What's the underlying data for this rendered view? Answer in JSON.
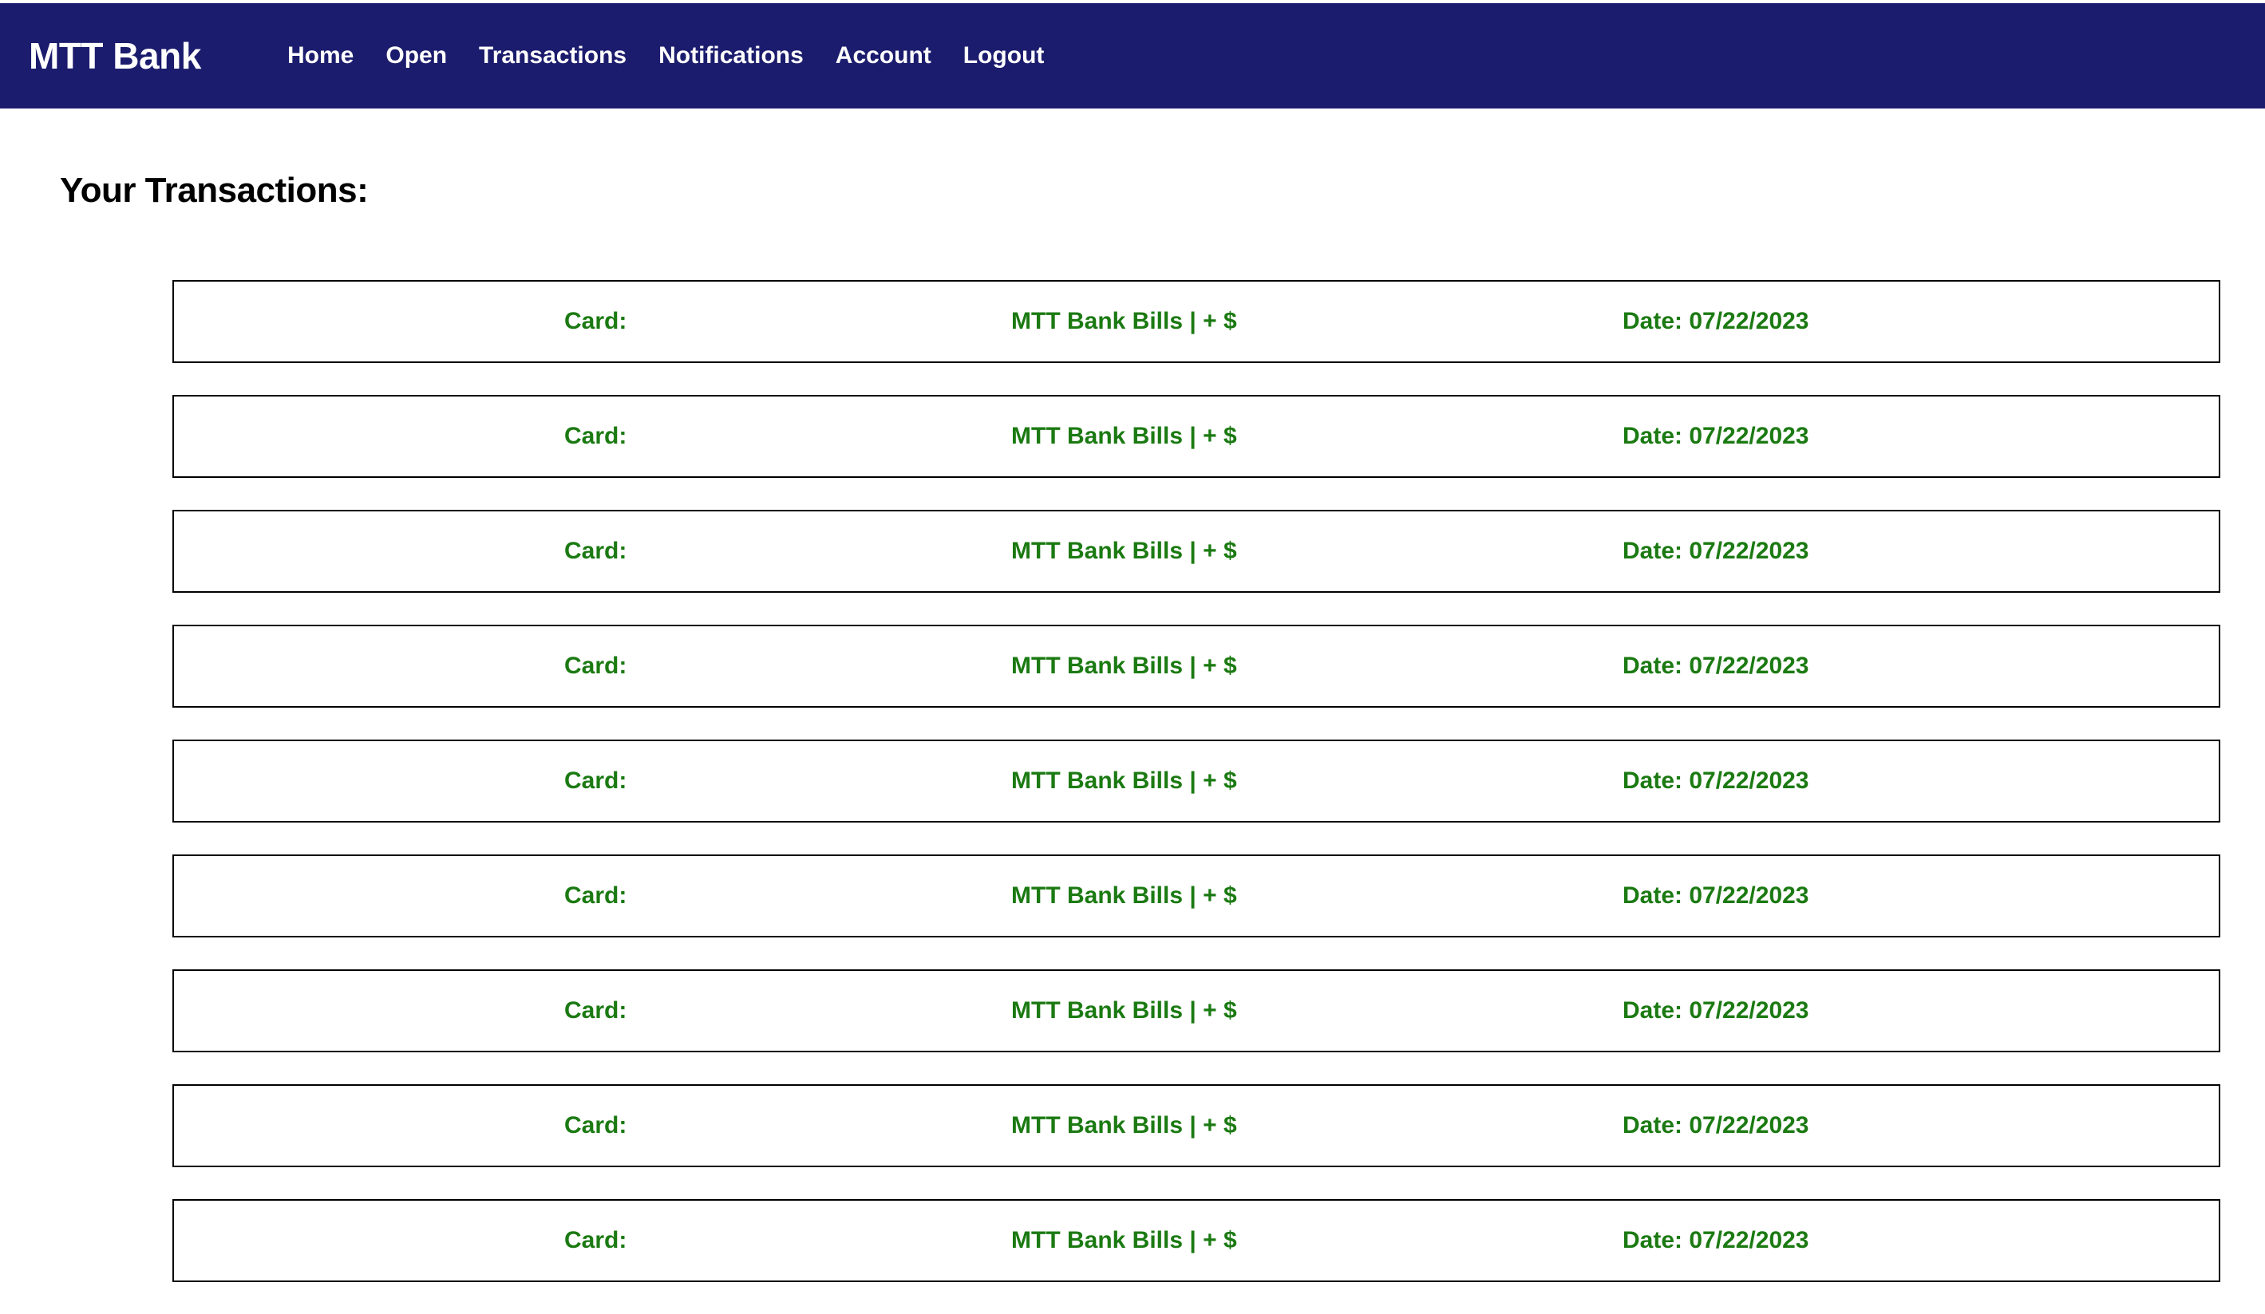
{
  "navbar": {
    "brand": "MTT Bank",
    "links": [
      "Home",
      "Open",
      "Transactions",
      "Notifications",
      "Account",
      "Logout"
    ],
    "background_color": "#1c1c6e"
  },
  "main": {
    "title": "Your Transactions:",
    "text_color": "#1b7a12",
    "transactions": [
      {
        "card": "Card:",
        "description": "MTT Bank Bills | + $",
        "date": "Date: 07/22/2023"
      },
      {
        "card": "Card:",
        "description": "MTT Bank Bills | + $",
        "date": "Date: 07/22/2023"
      },
      {
        "card": "Card:",
        "description": "MTT Bank Bills | + $",
        "date": "Date: 07/22/2023"
      },
      {
        "card": "Card:",
        "description": "MTT Bank Bills | + $",
        "date": "Date: 07/22/2023"
      },
      {
        "card": "Card:",
        "description": "MTT Bank Bills | + $",
        "date": "Date: 07/22/2023"
      },
      {
        "card": "Card:",
        "description": "MTT Bank Bills | + $",
        "date": "Date: 07/22/2023"
      },
      {
        "card": "Card:",
        "description": "MTT Bank Bills | + $",
        "date": "Date: 07/22/2023"
      },
      {
        "card": "Card:",
        "description": "MTT Bank Bills | + $",
        "date": "Date: 07/22/2023"
      },
      {
        "card": "Card:",
        "description": "MTT Bank Bills | + $",
        "date": "Date: 07/22/2023"
      }
    ]
  }
}
